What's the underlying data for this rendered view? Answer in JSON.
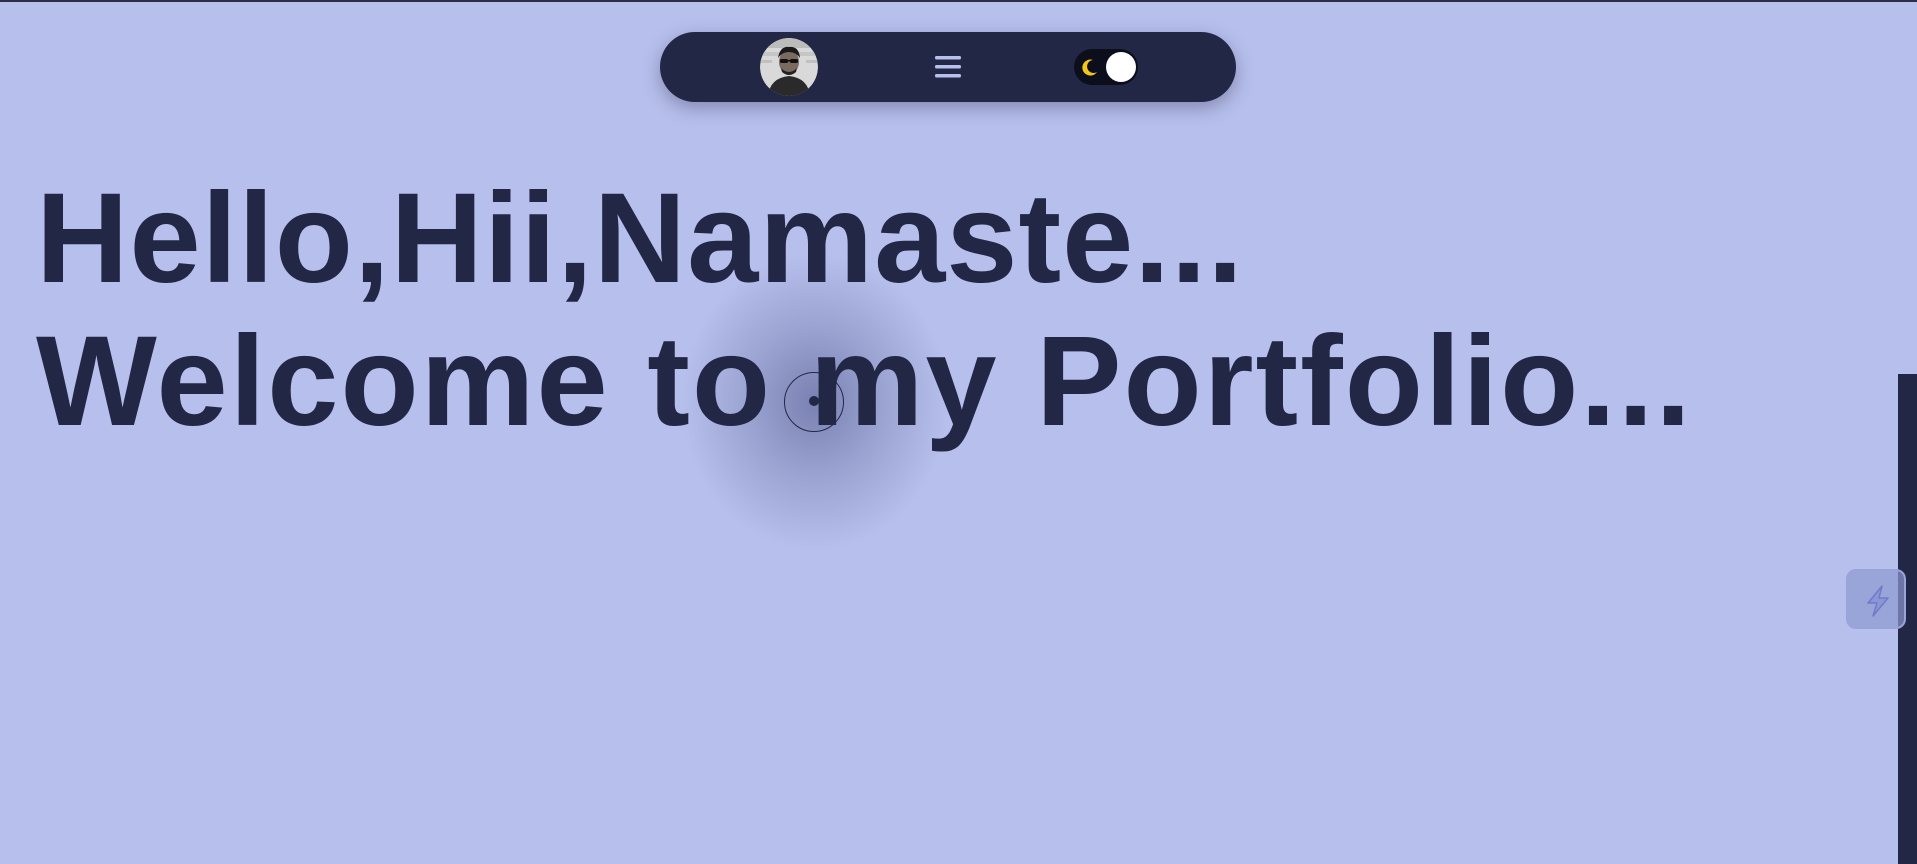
{
  "navbar": {
    "avatar_icon": "profile-avatar",
    "menu_icon": "hamburger-menu-icon",
    "theme_toggle": {
      "icon": "moon-icon",
      "state": "dark-mode-toggle"
    }
  },
  "hero": {
    "line1": "Hello,Hii,Namaste...",
    "line2": "Welcome to my Portfolio..."
  },
  "side_widget": {
    "icon": "lightning-bolt-icon"
  },
  "colors": {
    "background": "#b7bfec",
    "primary": "#232746",
    "moon": "#f5c518",
    "toggle_knob": "#ffffff"
  }
}
